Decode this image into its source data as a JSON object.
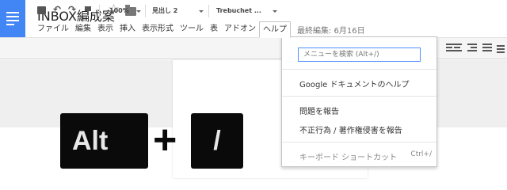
{
  "doc": {
    "title": "INBOX編成案",
    "star_icon": "star-outline",
    "folder_icon": "folder"
  },
  "menu": {
    "items": [
      "ファイル",
      "編集",
      "表示",
      "挿入",
      "表示形式",
      "ツール",
      "表",
      "アドオン",
      "ヘルプ"
    ],
    "active_item": "ヘルプ",
    "last_edit": "最終編集: 6月16日"
  },
  "toolbar": {
    "zoom": "100%",
    "style": "見出し 2",
    "font": "Trebuchet ...",
    "icons": [
      "printer-icon",
      "undo-icon",
      "redo-icon",
      "paint-format-icon",
      "align-icons",
      "line-spacing-icon"
    ]
  },
  "help_menu": {
    "search_placeholder": "メニューを検索 (Alt+/)",
    "items": [
      {
        "label": "Google ドキュメントのヘルプ"
      },
      {
        "label": "問題を報告"
      },
      {
        "label": "不正行為 / 著作権侵害を報告"
      },
      {
        "label": "キーボード ショートカット",
        "shortcut": "Ctrl+/"
      }
    ]
  },
  "keys": {
    "alt": "Alt",
    "plus": "+",
    "slash": "/"
  },
  "colors": {
    "docs_blue": "#4285f4",
    "focus_blue": "#4d90fe",
    "key_black": "#0a0a0a"
  }
}
